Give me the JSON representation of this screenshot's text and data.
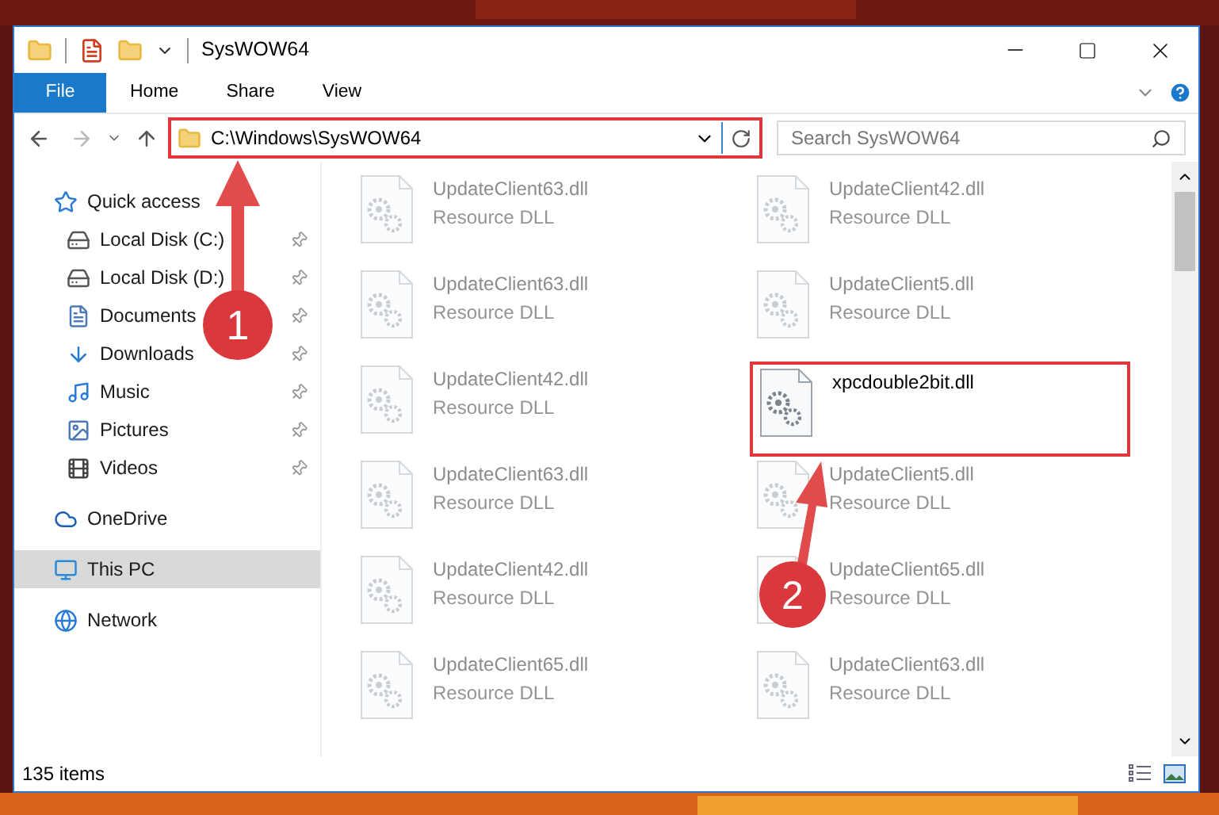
{
  "window": {
    "title": "SysWOW64"
  },
  "ribbon": {
    "tabs": [
      {
        "label": "File",
        "kind": "menu"
      },
      {
        "label": "Home",
        "kind": "tab"
      },
      {
        "label": "Share",
        "kind": "tab"
      },
      {
        "label": "View",
        "kind": "tab"
      }
    ]
  },
  "address_bar": {
    "path": "C:\\Windows\\SysWOW64",
    "highlighted": true
  },
  "search": {
    "placeholder": "Search SysWOW64"
  },
  "sidebar": {
    "items": [
      {
        "label": "Quick access",
        "kind": "star",
        "selected": false,
        "children": [
          {
            "label": "Local Disk (C:)",
            "kind": "system-disk",
            "pinned": true,
            "selected": false
          },
          {
            "label": "Local Disk (D:)",
            "kind": "disk",
            "pinned": true,
            "selected": false
          },
          {
            "label": "Documents",
            "kind": "documents",
            "pinned": true,
            "selected": false
          },
          {
            "label": "Downloads",
            "kind": "downloads",
            "pinned": true,
            "selected": false
          },
          {
            "label": "Music",
            "kind": "music",
            "pinned": true,
            "selected": false
          },
          {
            "label": "Pictures",
            "kind": "pictures",
            "pinned": true,
            "selected": false
          },
          {
            "label": "Videos",
            "kind": "videos",
            "pinned": true,
            "selected": false
          }
        ]
      },
      {
        "label": "OneDrive",
        "kind": "cloud",
        "selected": false
      },
      {
        "label": "This PC",
        "kind": "pc",
        "selected": true
      },
      {
        "label": "Network",
        "kind": "network",
        "selected": false
      }
    ]
  },
  "files": [
    {
      "name": "UpdateClient63.dll",
      "type": "Resource DLL",
      "highlighted": false
    },
    {
      "name": "UpdateClient42.dll",
      "type": "Resource DLL",
      "highlighted": false
    },
    {
      "name": "UpdateClient63.dll",
      "type": "Resource DLL",
      "highlighted": false
    },
    {
      "name": "UpdateClient5.dll",
      "type": "Resource DLL",
      "highlighted": false
    },
    {
      "name": "UpdateClient42.dll",
      "type": "Resource DLL",
      "highlighted": false
    },
    {
      "name": "xpcdouble2bit.dll",
      "highlighted": true
    },
    {
      "name": "UpdateClient63.dll",
      "type": "Resource DLL",
      "highlighted": false
    },
    {
      "name": "UpdateClient5.dll",
      "type": "Resource DLL",
      "highlighted": false
    },
    {
      "name": "UpdateClient42.dll",
      "type": "Resource DLL",
      "highlighted": false
    },
    {
      "name": "UpdateClient65.dll",
      "type": "Resource DLL",
      "highlighted": false
    },
    {
      "name": "UpdateClient65.dll",
      "type": "Resource DLL",
      "highlighted": false
    },
    {
      "name": "UpdateClient63.dll",
      "type": "Resource DLL",
      "highlighted": false
    }
  ],
  "annotations": [
    {
      "label": "1"
    },
    {
      "label": "2"
    }
  ],
  "status_bar": {
    "item_count": "135 items"
  }
}
